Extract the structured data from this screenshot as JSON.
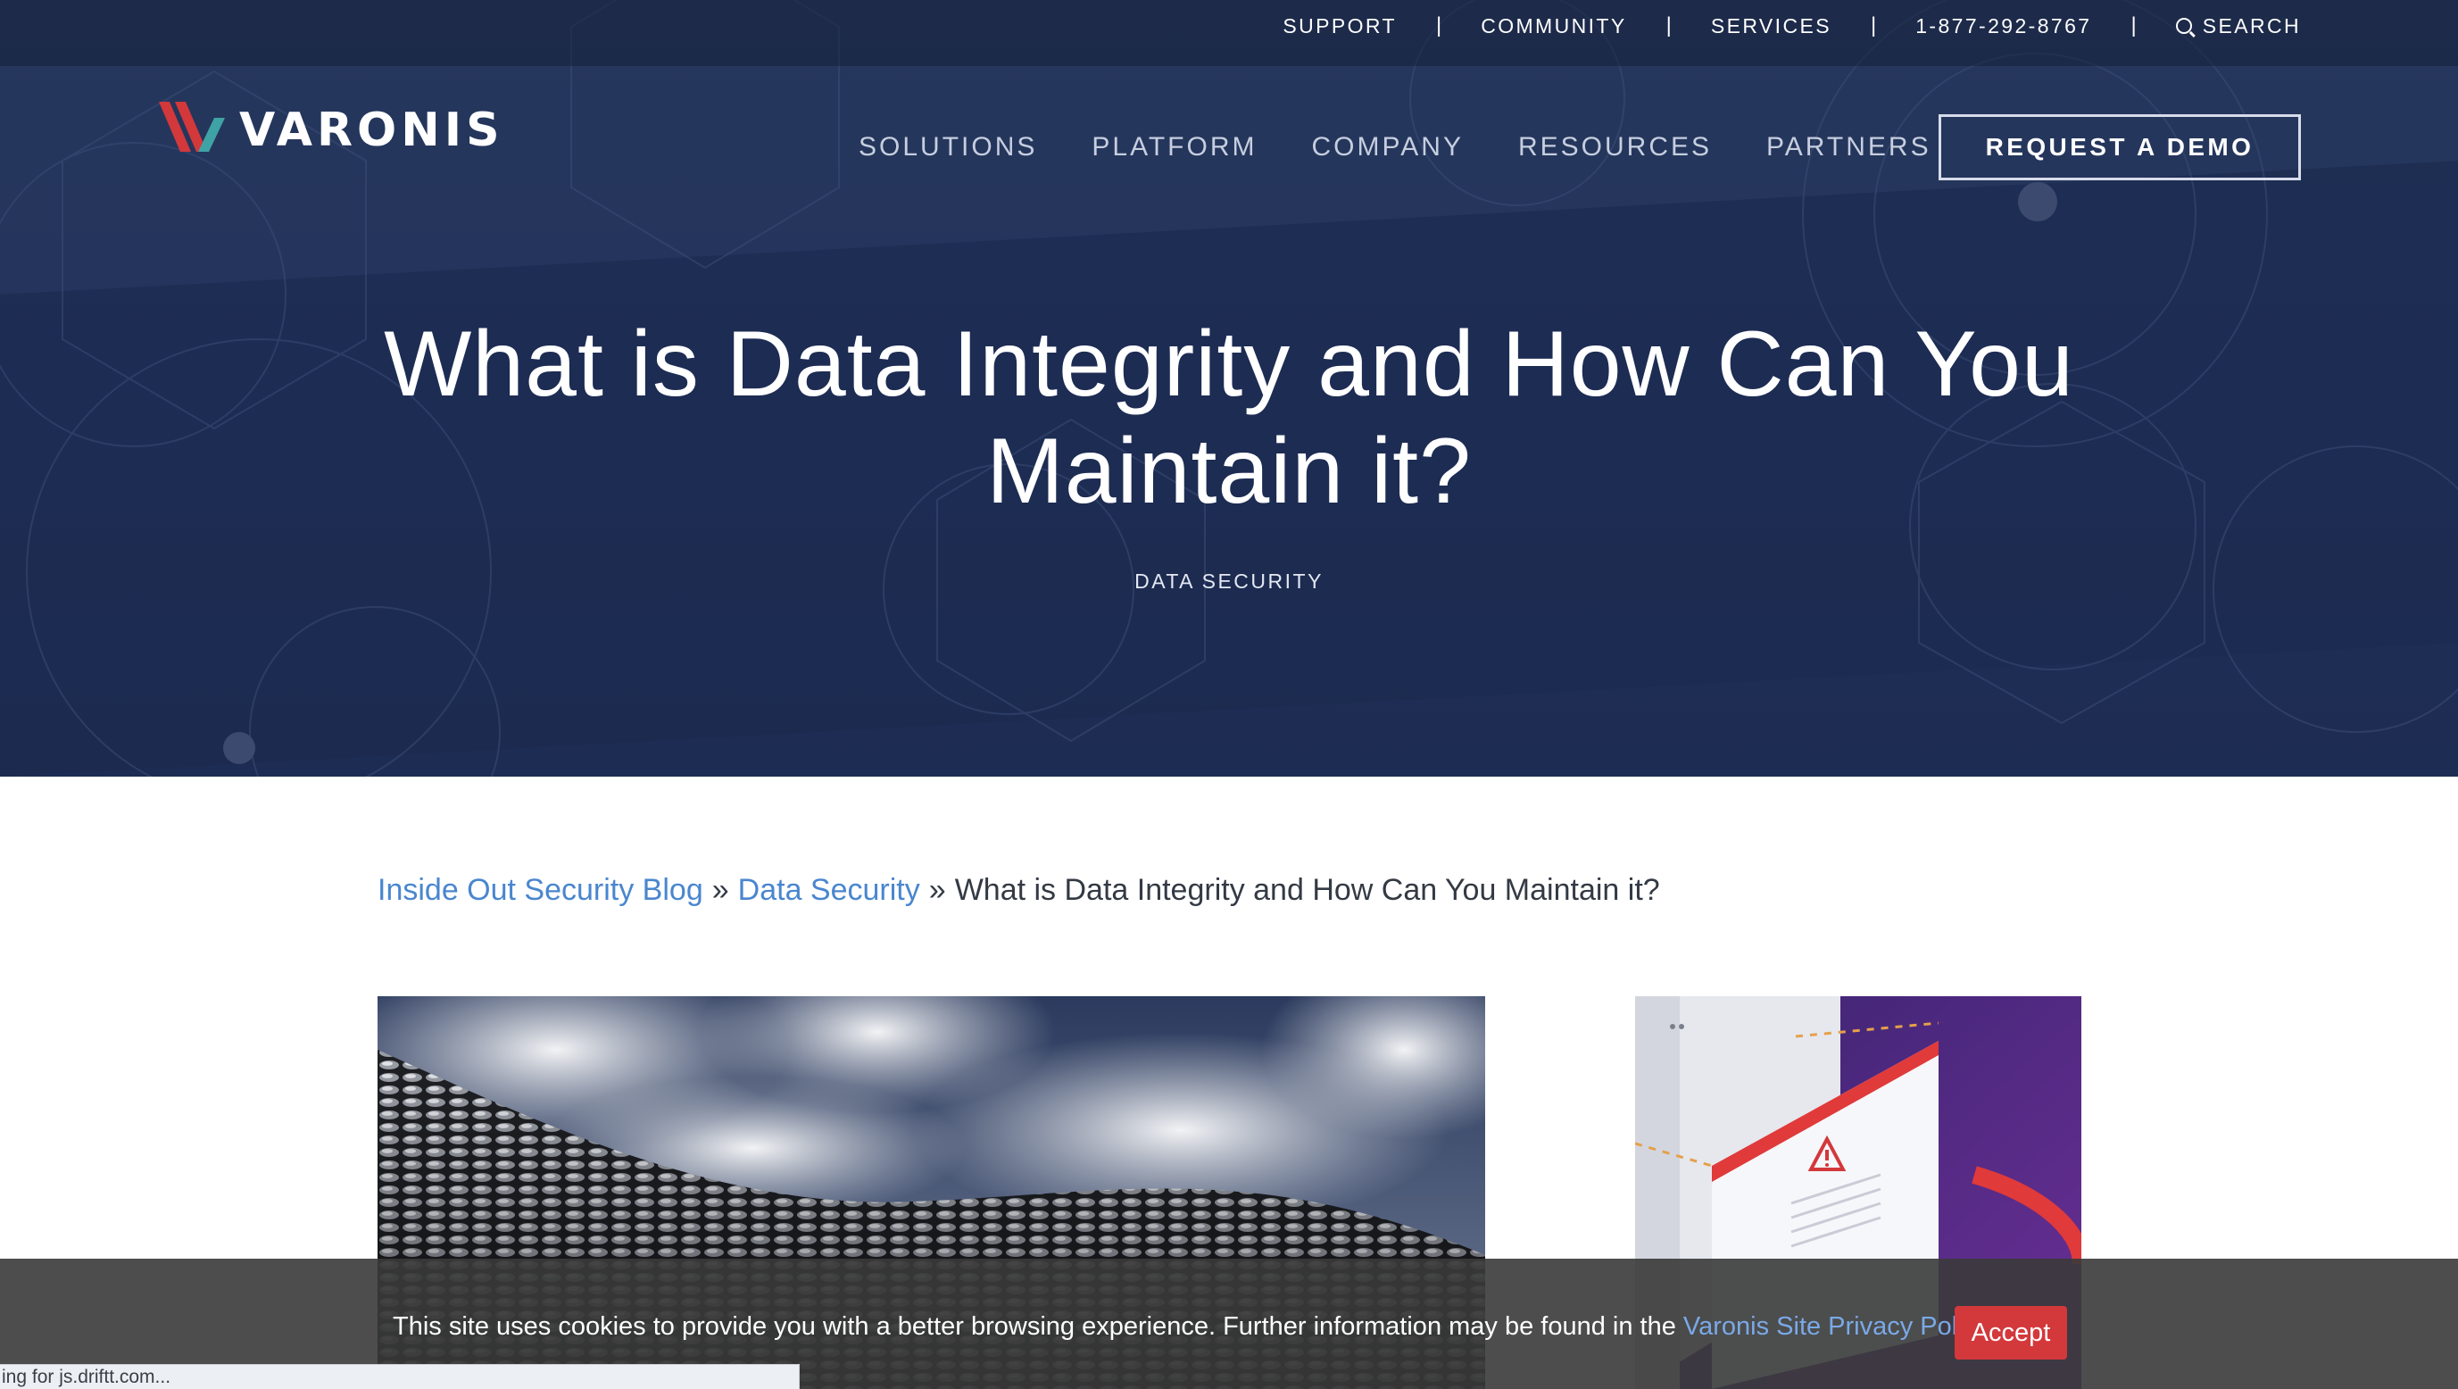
{
  "utility_nav": {
    "support": "SUPPORT",
    "community": "COMMUNITY",
    "services": "SERVICES",
    "phone": "1-877-292-8767",
    "search": "SEARCH",
    "separator": "|"
  },
  "brand": {
    "name": "VARONIS"
  },
  "main_nav": {
    "solutions": "SOLUTIONS",
    "platform": "PLATFORM",
    "company": "COMPANY",
    "resources": "RESOURCES",
    "partners": "PARTNERS",
    "demo": "REQUEST A DEMO"
  },
  "hero": {
    "title": "What is Data Integrity and How Can You Maintain it?",
    "category": "DATA SECURITY"
  },
  "breadcrumb": {
    "home": "Inside Out Security Blog",
    "separator": "»",
    "section": "Data Security",
    "current": "What is Data Integrity and How Can You Maintain it?"
  },
  "cookie": {
    "text": "This site uses cookies to provide you with a better browsing experience. Further information may be found in the",
    "link": "Varonis Site Privacy Policy",
    "accept": "Accept"
  },
  "status_bar": {
    "text": "ing for js.driftt.com..."
  },
  "colors": {
    "hero_bg": "#21305a",
    "link": "#4a86cf",
    "accept": "#d3383b",
    "logo_red": "#d3383b",
    "logo_teal": "#3fa3a5"
  }
}
